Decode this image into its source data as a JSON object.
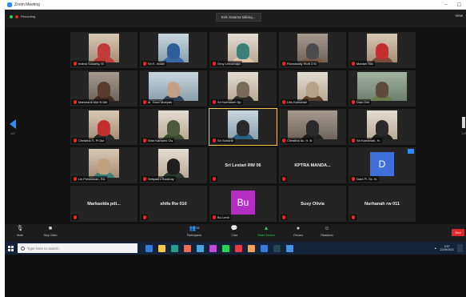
{
  "window": {
    "title": "Zoom Meeting",
    "controls": [
      "–",
      "☐"
    ]
  },
  "recording": {
    "label": "Recording"
  },
  "talking": {
    "label": "Erik Sutarsa talking..."
  },
  "view": {
    "label": "View"
  },
  "grid": {
    "page_left": "1/2",
    "page_right": "1/2",
    "tiles": [
      {
        "type": "video",
        "name": "Indina Susanty, M",
        "style": "v1",
        "head": "#c23b3b",
        "body": "#c23b3b"
      },
      {
        "type": "video",
        "name": "Sri K. Indah",
        "style": "v2",
        "head": "#2f5f9a",
        "body": "#3a6aa5"
      },
      {
        "type": "video",
        "name": "Orcy Lemamajic",
        "style": "v3",
        "head": "#3c7f7a",
        "body": "#e0c3a8"
      },
      {
        "type": "video",
        "name": "Rismawaty Rioft 3 Ki",
        "style": "v4",
        "head": "#4c4c4c",
        "body": "#7a5e4a"
      },
      {
        "type": "video",
        "name": "Mariani Riiv",
        "style": "v1",
        "head": "#c32f2f",
        "body": "#7a4a3a"
      },
      {
        "type": "video",
        "name": "Marshanti Mut N Diti",
        "style": "v4",
        "head": "#5a3b2f",
        "body": "#3d2a22"
      },
      {
        "type": "video",
        "name": "dr. Tanvi Mueyan",
        "style": "v2",
        "head": "#c2a087",
        "body": "#2f3f55",
        "wide": true
      },
      {
        "type": "video",
        "name": "Sri Nurhaseh Sp.",
        "style": "v3",
        "head": "#7a6a58",
        "body": "#2a2a2a"
      },
      {
        "type": "video",
        "name": "Lilis Kamarfah",
        "style": "v3",
        "head": "#b7a289",
        "body": "#5a3f2a"
      },
      {
        "type": "video",
        "name": "Dian Emi",
        "style": "v5",
        "head": "#5d4a3b",
        "body": "#6a7b4c",
        "wide": true
      },
      {
        "type": "video",
        "name": "Christina S. Pi Dia",
        "style": "v1",
        "head": "#c32f2f",
        "body": "#2a2a2a"
      },
      {
        "type": "video",
        "name": "Wiar Kartarini Ow",
        "style": "v3",
        "head": "#4a5a3a",
        "body": "#3d4a2f"
      },
      {
        "type": "video",
        "name": "Sri Suhanti",
        "style": "v2",
        "head": "#2a2a2a",
        "body": "#2a5f80",
        "speaking": true
      },
      {
        "type": "video",
        "name": "Christina dc. H. B",
        "style": "v4",
        "head": "#2a2a2a",
        "body": "#1e1e1e",
        "wide": true
      },
      {
        "type": "video",
        "name": "Sri Kartamah, H.",
        "style": "v3",
        "head": "#2a2a2a",
        "body": "#1e1e1e"
      },
      {
        "type": "video",
        "name": "Lis Purlahmah, Rd.",
        "style": "v1",
        "head": "#c0a07e",
        "body": "#3c7f7a"
      },
      {
        "type": "video",
        "name": "Setiyadhi Rarahay",
        "style": "v3",
        "head": "#1f1f1f",
        "body": "#2a3a2a"
      },
      {
        "type": "name",
        "name": "Sri Lestari RW 06"
      },
      {
        "type": "name",
        "name": "KPTRA MANDA..."
      },
      {
        "type": "initial",
        "name": "Dani Pi. Sc. N.",
        "letter": "D",
        "color": "#3f6fd8",
        "share": true
      },
      {
        "type": "name",
        "name": "Markaolda pdi..."
      },
      {
        "type": "name",
        "name": "shifa Rw 010"
      },
      {
        "type": "initial",
        "name": "Bu Lenti",
        "letter": "Bu",
        "color": "#b42ec4"
      },
      {
        "type": "name",
        "name": "Susy Olivia"
      },
      {
        "type": "name",
        "name": "Nurhanah rw 011"
      }
    ]
  },
  "controls": {
    "mute": "Mute",
    "stop_video": "Stop Video",
    "participants": "Participants",
    "participants_count": "39",
    "chat": "Chat",
    "share_screen": "Share Screen",
    "record": "Record",
    "reactions": "Reactions",
    "end": "End"
  },
  "taskbar": {
    "search_placeholder": "Type here to search",
    "apps": [
      "#3a7bd5",
      "#f2c94c",
      "#2a9d8f",
      "#e76f51",
      "#4aa3df",
      "#c24bd6",
      "#2bd156",
      "#e63946",
      "#f4a261",
      "#3a7bd5",
      "#264653",
      "#4a90e2"
    ],
    "time": "9:57",
    "date": "21/09/2021"
  }
}
